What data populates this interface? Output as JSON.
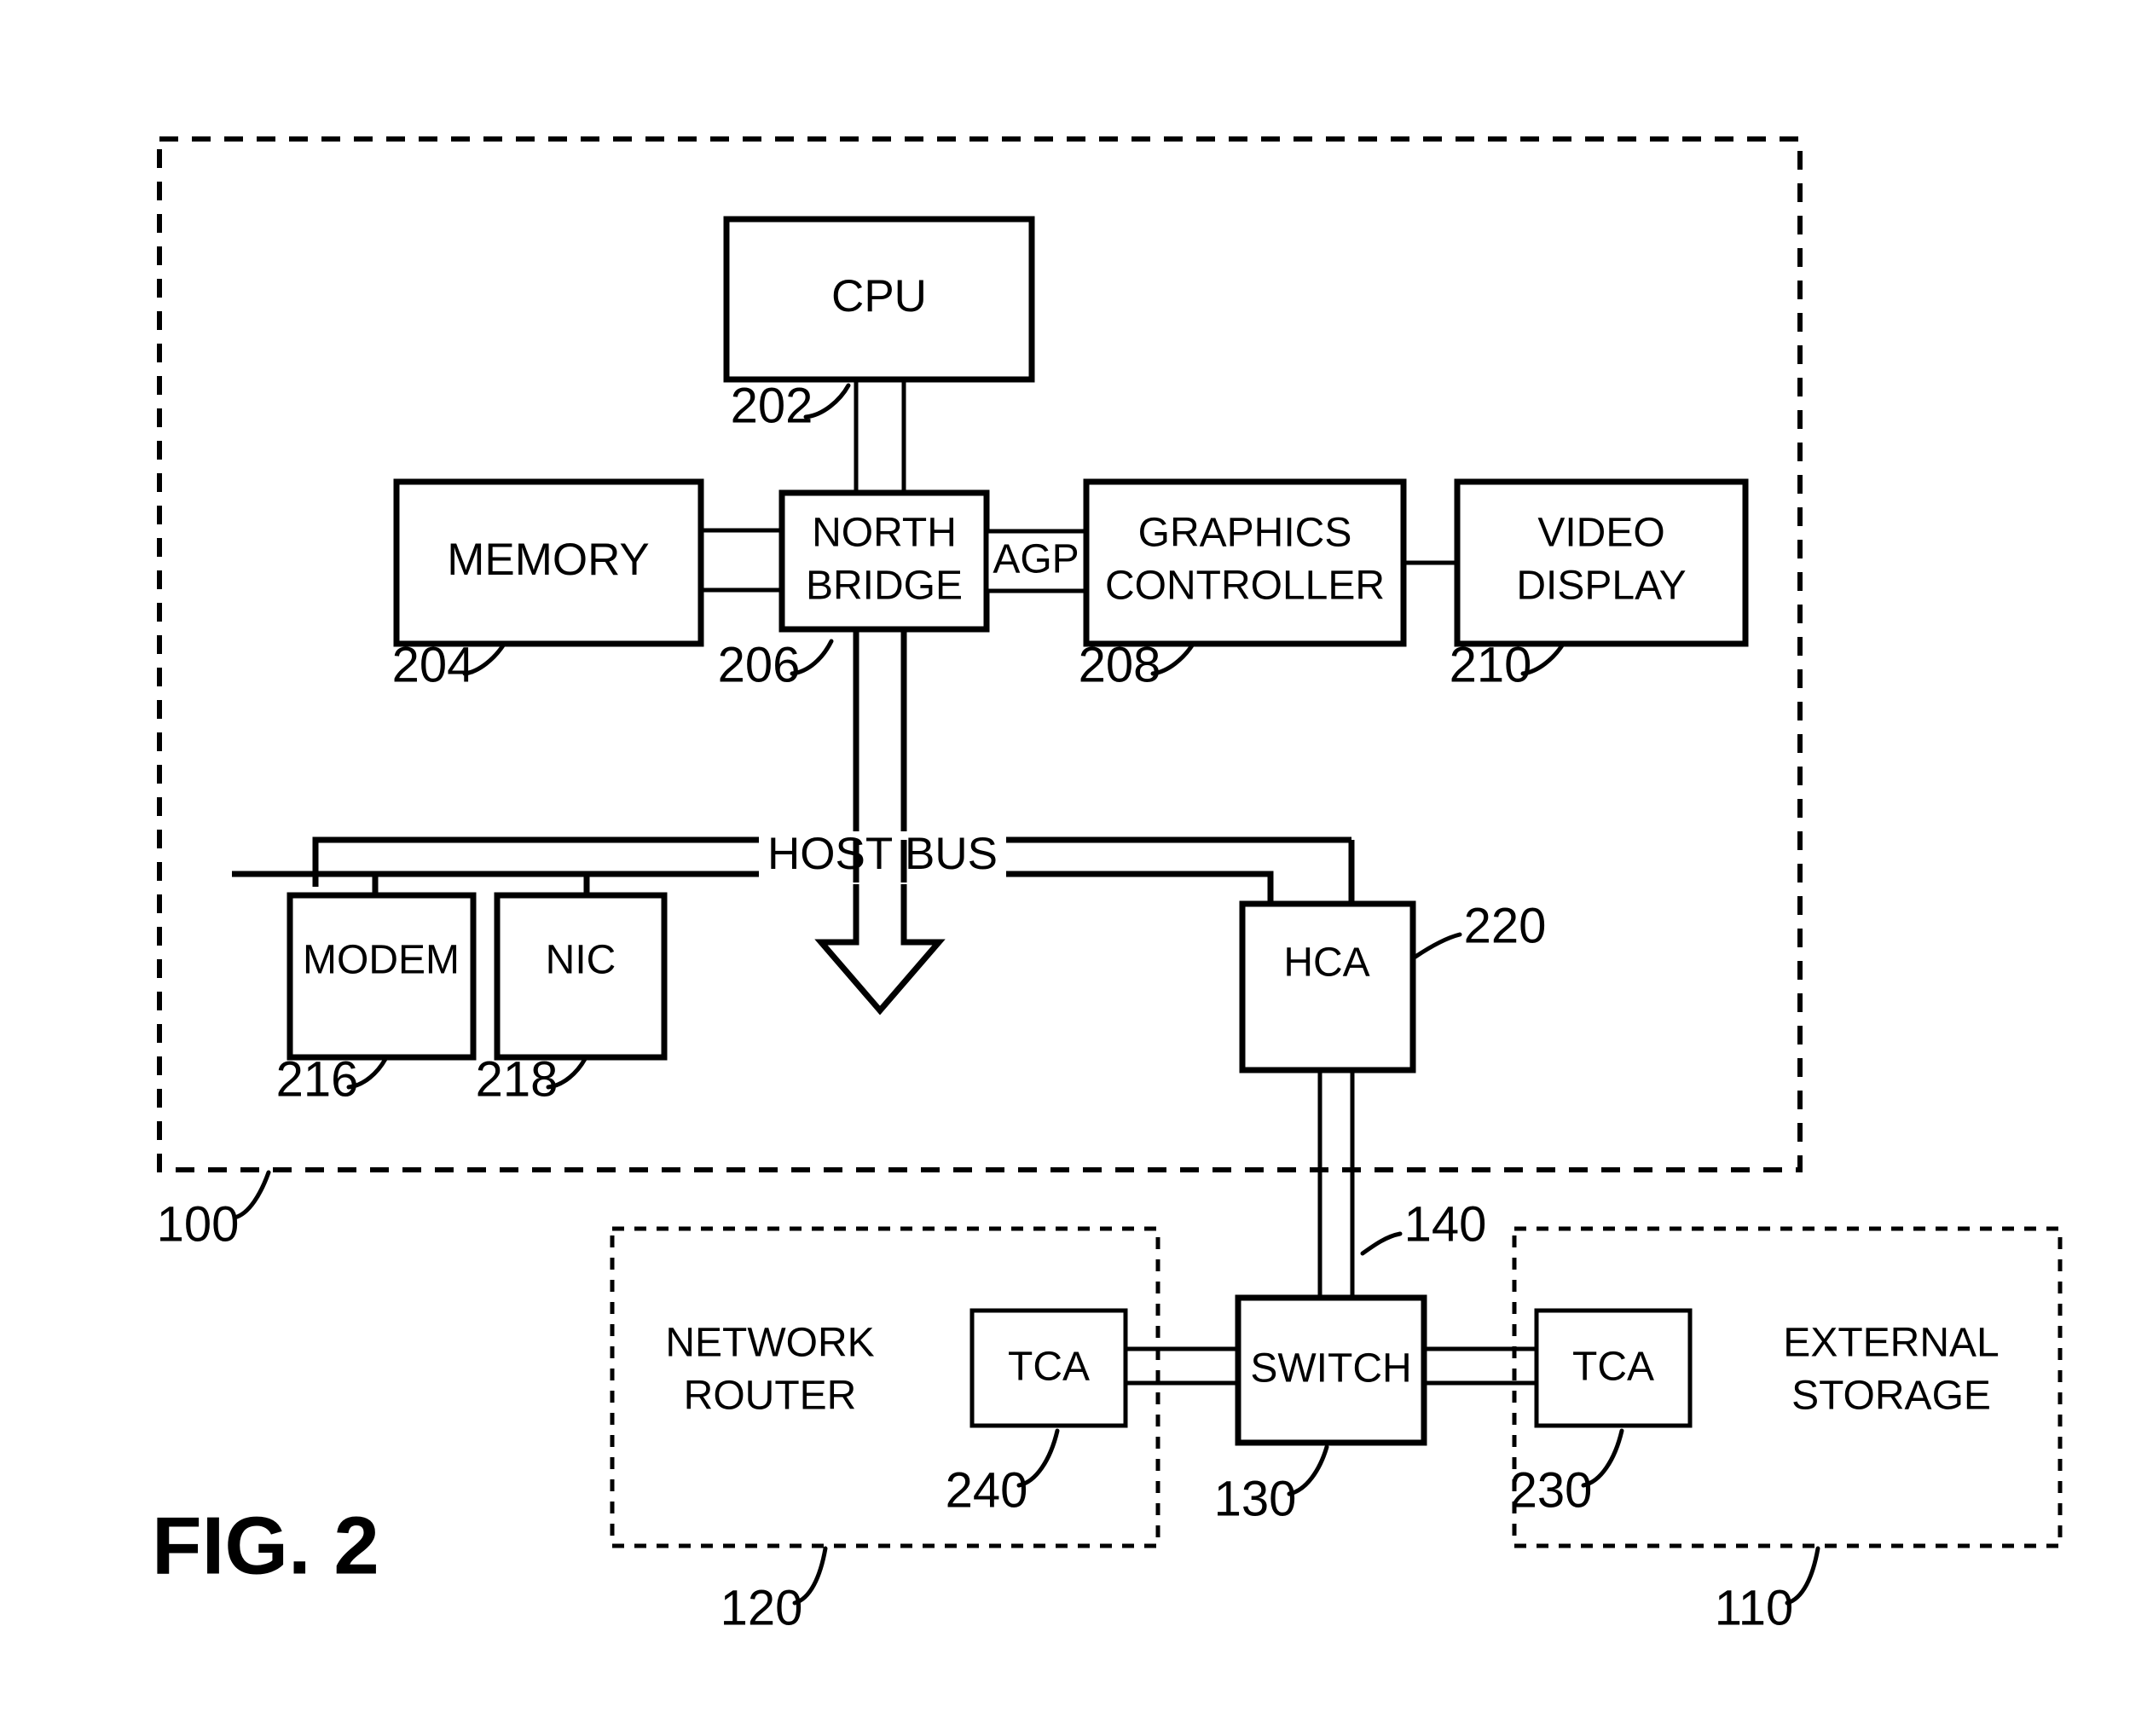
{
  "figure": {
    "title": "FIG. 2",
    "caption_label": "FIG. 2"
  },
  "enclosures": [
    {
      "id": "host-system",
      "ref": "100",
      "style": "dashed"
    },
    {
      "id": "network-router",
      "ref": "120",
      "label": "NETWORK\nROUTER",
      "line1": "NETWORK",
      "line2": "ROUTER",
      "style": "dashed"
    },
    {
      "id": "external-storage",
      "ref": "110",
      "label": "EXTERNAL\nSTORAGE",
      "line1": "EXTERNAL",
      "line2": "STORAGE",
      "style": "dashed"
    }
  ],
  "blocks": {
    "cpu": {
      "label": "CPU",
      "ref": "202"
    },
    "memory": {
      "label": "MEMORY",
      "ref": "204"
    },
    "northbridge": {
      "label_line1": "NORTH",
      "label_line2": "BRIDGE",
      "ref": "206"
    },
    "graphics": {
      "label_line1": "GRAPHICS",
      "label_line2": "CONTROLLER",
      "ref": "208"
    },
    "video": {
      "label_line1": "VIDEO",
      "label_line2": "DISPLAY",
      "ref": "210"
    },
    "modem": {
      "label": "MODEM",
      "ref": "216"
    },
    "nic": {
      "label": "NIC",
      "ref": "218"
    },
    "hca": {
      "label": "HCA",
      "ref": "220"
    },
    "switch": {
      "label": "SWITCH",
      "ref": "130"
    },
    "tca_storage": {
      "label": "TCA",
      "ref": "230"
    },
    "tca_router": {
      "label": "TCA",
      "ref": "240"
    },
    "network_router": {
      "line1": "NETWORK",
      "line2": "ROUTER",
      "ref": "120"
    },
    "external_storage": {
      "line1": "EXTERNAL",
      "line2": "STORAGE",
      "ref": "110"
    }
  },
  "buses": {
    "agp": {
      "label": "AGP"
    },
    "host_bus": {
      "label": "HOST BUS"
    },
    "link_140": {
      "ref": "140"
    }
  },
  "reference_numerals": [
    "100",
    "110",
    "120",
    "130",
    "140",
    "202",
    "204",
    "206",
    "208",
    "210",
    "216",
    "218",
    "220",
    "230",
    "240"
  ],
  "colors": {
    "ink": "#000000",
    "paper": "#ffffff"
  }
}
